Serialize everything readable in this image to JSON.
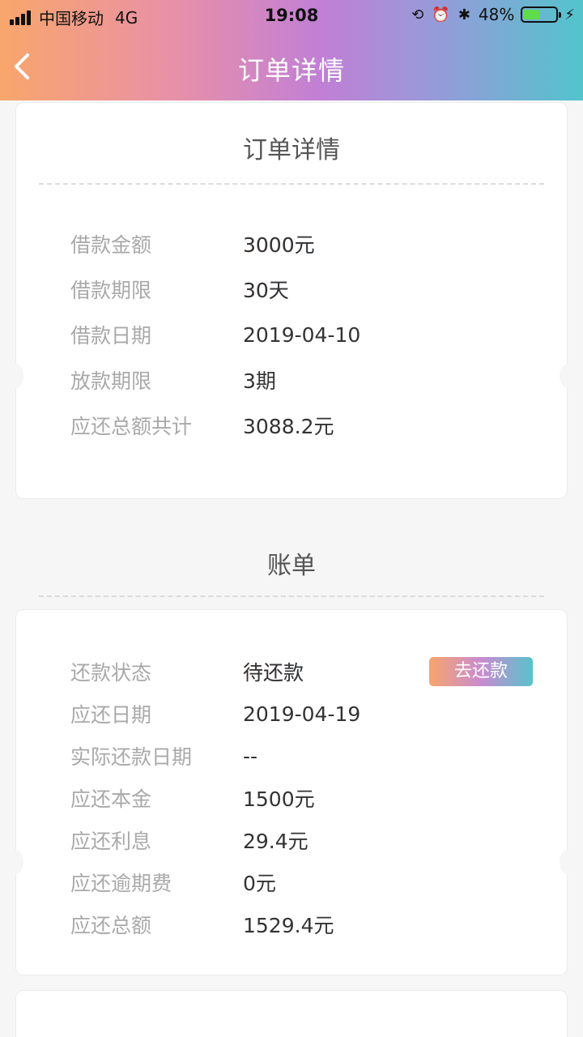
{
  "status_bar": {
    "carrier": "中国移动",
    "network": "4G",
    "time": "19:08",
    "battery": "48%",
    "battery_level": 0.48
  },
  "nav": {
    "title": "订单详情"
  },
  "order": {
    "section_title": "订单详情",
    "rows": [
      {
        "label": "借款金额",
        "value": "3000元"
      },
      {
        "label": "借款期限",
        "value": "30天"
      },
      {
        "label": "借款日期",
        "value": "2019-04-10"
      },
      {
        "label": "放款期限",
        "value": "3期"
      },
      {
        "label": "应还总额共计",
        "value": "3088.2元"
      }
    ]
  },
  "bill": {
    "section_title": "账单",
    "pay_button": "去还款",
    "rows": [
      {
        "label": "还款状态",
        "value": "待还款"
      },
      {
        "label": "应还日期",
        "value": "2019-04-19"
      },
      {
        "label": "实际还款日期",
        "value": "--"
      },
      {
        "label": "应还本金",
        "value": "1500元"
      },
      {
        "label": "应还利息",
        "value": "29.4元"
      },
      {
        "label": "应还逾期费",
        "value": "0元"
      },
      {
        "label": "应还总额",
        "value": "1529.4元"
      }
    ]
  },
  "colors": {
    "gradient_start": "#f9a66c",
    "gradient_mid": "#c17fd6",
    "gradient_end": "#52c4cc",
    "label": "#a9a9a9",
    "value": "#333333"
  }
}
